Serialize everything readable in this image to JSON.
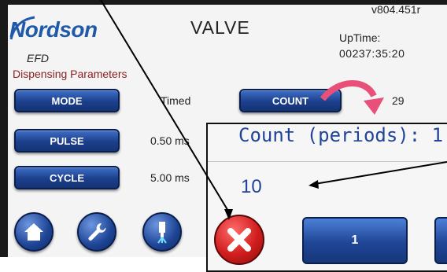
{
  "header": {
    "brand": "Nordson",
    "brand_sub": "EFD",
    "title": "VALVE",
    "version": "v804.451r",
    "uptime_label": "UpTime:",
    "uptime_value": "00237:35:20",
    "section_label": "Dispensing Parameters"
  },
  "params": [
    {
      "label": "MODE",
      "value": "Timed"
    },
    {
      "label": "PULSE",
      "value": "0.50 ms"
    },
    {
      "label": "CYCLE",
      "value": "5.00 ms"
    }
  ],
  "count": {
    "label": "COUNT",
    "value": "29"
  },
  "popup": {
    "title": "Count (periods): 1",
    "value": "10",
    "key_1": "1"
  },
  "icons": {
    "home": "home-icon",
    "settings": "wrench-icon",
    "dispense": "dispense-valve-icon",
    "cancel": "close-icon"
  },
  "colors": {
    "accent": "#21449a",
    "button": "#1c3f8c",
    "cancel": "#d11d1d",
    "section_label": "#8a1e1e",
    "arrow_pink": "#e8507a"
  }
}
